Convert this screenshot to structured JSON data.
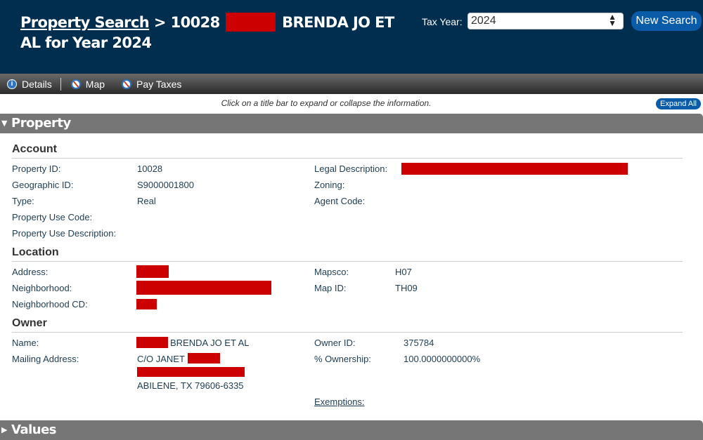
{
  "header": {
    "breadcrumb_link": "Property Search",
    "title_prefix": "> 10028",
    "title_suffix": "BRENDA JO ET AL for Year 2024",
    "tax_year_label": "Tax Year:",
    "tax_year_value": "2024",
    "new_search_label": "New Search"
  },
  "toolbar": {
    "items": [
      {
        "label": "Details",
        "icon": "info-icon"
      },
      {
        "label": "Map",
        "icon": "compass-icon"
      },
      {
        "label": "Pay Taxes",
        "icon": "compass-icon"
      }
    ]
  },
  "hint": "Click on a title bar to expand or collapse the information.",
  "expand_all_label": "Expand All",
  "sections": {
    "property": {
      "title": "Property",
      "account": {
        "heading": "Account",
        "property_id_label": "Property ID:",
        "property_id": "10028",
        "geographic_id_label": "Geographic ID:",
        "geographic_id": "S9000001800",
        "type_label": "Type:",
        "type": "Real",
        "use_code_label": "Property Use Code:",
        "use_code": "",
        "use_desc_label": "Property Use Description:",
        "use_desc": "",
        "legal_desc_label": "Legal Description:",
        "legal_desc": "[redacted]",
        "zoning_label": "Zoning:",
        "zoning": "",
        "agent_code_label": "Agent Code:",
        "agent_code": ""
      },
      "location": {
        "heading": "Location",
        "address_label": "Address:",
        "address": "[redacted]",
        "neighborhood_label": "Neighborhood:",
        "neighborhood": "[redacted]",
        "neighborhood_cd_label": "Neighborhood CD:",
        "neighborhood_cd": "[redacted]",
        "mapsco_label": "Mapsco:",
        "mapsco": "H07",
        "map_id_label": "Map ID:",
        "map_id": "TH09"
      },
      "owner": {
        "heading": "Owner",
        "name_label": "Name:",
        "name_suffix": "BRENDA JO ET AL",
        "mailing_label": "Mailing Address:",
        "mailing_line1": "C/O JANET",
        "mailing_line3": "ABILENE, TX 79606-6335",
        "owner_id_label": "Owner ID:",
        "owner_id": "375784",
        "ownership_label": "% Ownership:",
        "ownership": "100.0000000000%",
        "exemptions_label": "Exemptions:"
      }
    },
    "values": {
      "title": "Values"
    }
  }
}
